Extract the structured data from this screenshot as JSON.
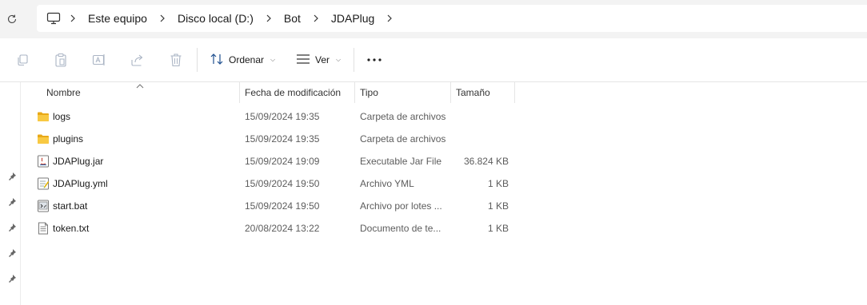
{
  "addressbar": {
    "refresh_icon": "refresh-icon",
    "computer_icon": "computer-icon",
    "breadcrumbs": [
      "Este equipo",
      "Disco local (D:)",
      "Bot",
      "JDAPlug"
    ]
  },
  "toolbar": {
    "sort_label": "Ordenar",
    "view_label": "Ver",
    "icons": [
      "copy-icon",
      "paste-icon",
      "rename-icon",
      "share-icon",
      "delete-icon",
      "sort-icon",
      "view-icon",
      "more-icon"
    ]
  },
  "columns": {
    "name": "Nombre",
    "date": "Fecha de modificación",
    "type": "Tipo",
    "size": "Tamaño"
  },
  "files": [
    {
      "name": "logs",
      "date": "15/09/2024 19:35",
      "type": "Carpeta de archivos",
      "size": "",
      "icon": "folder-icon"
    },
    {
      "name": "plugins",
      "date": "15/09/2024 19:35",
      "type": "Carpeta de archivos",
      "size": "",
      "icon": "folder-icon"
    },
    {
      "name": "JDAPlug.jar",
      "date": "15/09/2024 19:09",
      "type": "Executable Jar File",
      "size": "36.824 KB",
      "icon": "jar-file-icon"
    },
    {
      "name": "JDAPlug.yml",
      "date": "15/09/2024 19:50",
      "type": "Archivo YML",
      "size": "1 KB",
      "icon": "yml-file-icon"
    },
    {
      "name": "start.bat",
      "date": "15/09/2024 19:50",
      "type": "Archivo por lotes ...",
      "size": "1 KB",
      "icon": "bat-file-icon"
    },
    {
      "name": "token.txt",
      "date": "20/08/2024 13:22",
      "type": "Documento de te...",
      "size": "1 KB",
      "icon": "text-file-icon"
    }
  ],
  "colors": {
    "folder": "#f8c943",
    "accent": "#0067c0",
    "chrome_bg": "#f3f3f3"
  }
}
